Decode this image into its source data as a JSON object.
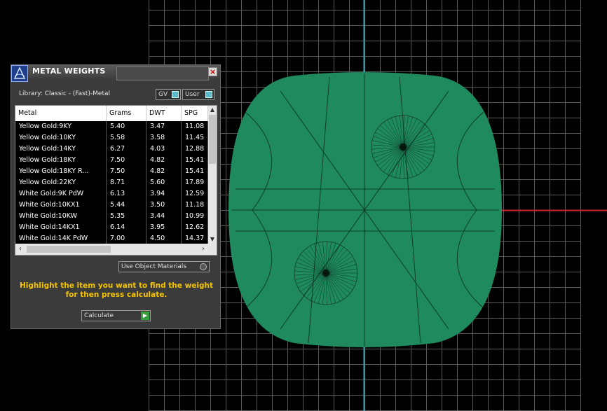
{
  "panel": {
    "title": "METAL WEIGHTS",
    "library_label": "Library: Classic - (Fast)-Metal",
    "toggle_gv": "GV",
    "toggle_user": "User",
    "columns": [
      "Metal",
      "Grams",
      "DWT",
      "SPG"
    ],
    "rows": [
      [
        "Yellow Gold:9KY",
        "5.40",
        "3.47",
        "11.08"
      ],
      [
        "Yellow Gold:10KY",
        "5.58",
        "3.58",
        "11.45"
      ],
      [
        "Yellow Gold:14KY",
        "6.27",
        "4.03",
        "12.88"
      ],
      [
        "Yellow Gold:18KY",
        "7.50",
        "4.82",
        "15.41"
      ],
      [
        "Yellow Gold:18KY R...",
        "7.50",
        "4.82",
        "15.41"
      ],
      [
        "Yellow Gold:22KY",
        "8.71",
        "5.60",
        "17.89"
      ],
      [
        "White Gold:9K PdW",
        "6.13",
        "3.94",
        "12.59"
      ],
      [
        "White Gold:10KX1",
        "5.44",
        "3.50",
        "11.18"
      ],
      [
        "White Gold:10KW",
        "5.35",
        "3.44",
        "10.99"
      ],
      [
        "White Gold:14KX1",
        "6.14",
        "3.95",
        "12.62"
      ],
      [
        "White Gold:14K PdW",
        "7.00",
        "4.50",
        "14.37"
      ]
    ],
    "use_object_materials": "Use Object Materials",
    "instructions_line1": "Highlight the item you want to find the weight",
    "instructions_line2": "for then press calculate.",
    "calculate_label": "Calculate"
  },
  "colors": {
    "model_green": "#1e8a5e",
    "instruction_yellow": "#f5c400",
    "axis_red": "#c82828",
    "axis_cyan": "#3aa7b8"
  },
  "icons": {
    "logo": "app-logo-icon",
    "close": "close-icon",
    "go": "play-arrow-icon"
  }
}
